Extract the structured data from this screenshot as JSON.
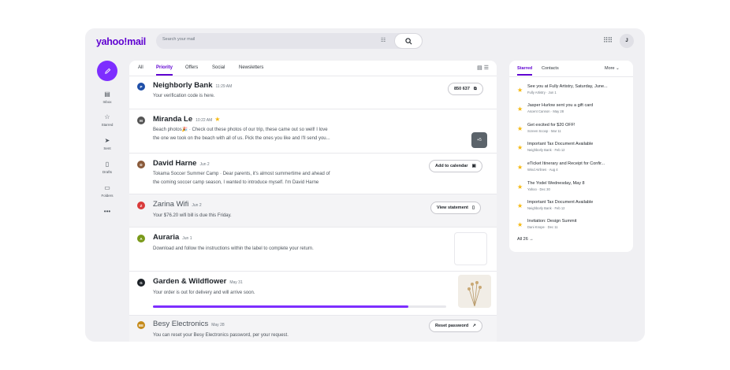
{
  "app": {
    "logo": "yahoo!mail"
  },
  "search": {
    "placeholder": "Search your mail"
  },
  "user": {
    "initial": "J"
  },
  "colors": {
    "accent": "#5f01d1",
    "compose": "#7d2eff",
    "star": "#f5b80e"
  },
  "rail": [
    {
      "label": "Inbox",
      "icon": "inbox-icon"
    },
    {
      "label": "Starred",
      "icon": "star-outline-icon"
    },
    {
      "label": "Sent",
      "icon": "send-icon"
    },
    {
      "label": "Drafts",
      "icon": "draft-icon"
    },
    {
      "label": "Folders",
      "icon": "folder-icon"
    }
  ],
  "tabs": [
    "All",
    "Priority",
    "Offers",
    "Social",
    "Newsletters"
  ],
  "active_tab": "Priority",
  "messages": [
    {
      "sender": "Neighborly Bank",
      "time": "11:29 AM",
      "snippet": "Your verification code is here.",
      "action": "850 637"
    },
    {
      "sender": "Miranda Le",
      "time": "10:22 AM",
      "snippet1": "Beach photos🎉 · Check out these photos of our trip, these came out so well! I love",
      "snippet2": "the one we took on the beach with all of us. Pick the ones you like and I'll send you...",
      "more": "+5"
    },
    {
      "sender": "David Harne",
      "time": "Jun 2",
      "snippet1": "Tokama Soccer Summer Camp · Dear parents, it's almost summertime and ahead of",
      "snippet2": "the coming soccer camp season, I wanted to introduce myself. I'm David Harne",
      "action": "Add to calendar"
    },
    {
      "sender": "Zarina Wifi",
      "time": "Jun 2",
      "snippet": "Your $76.20 wifi bill is due this Friday.",
      "action": "View statement"
    },
    {
      "sender": "Auraria",
      "time": "Jun 1",
      "snippet": "Download and follow the instructions within the label to complete your return."
    },
    {
      "sender": "Garden & Wildflower",
      "time": "May 31",
      "snippet": "Your order is out for delivery and will arrive soon.",
      "progress": 0.87
    },
    {
      "sender": "Besy Electronics",
      "time": "May 28",
      "snippet": "You can reset your Besy Electronics password, per your request.",
      "action": "Reset password"
    }
  ],
  "panel": {
    "tabs": [
      "Starred",
      "Contacts"
    ],
    "more": "More",
    "items": [
      {
        "title": "See you at Fully Artistry, Saturday, June...",
        "meta": "Fully Artistry · Jun 1"
      },
      {
        "title": "Jasper Hurlow sent you a gift card",
        "meta": "Ascent Cannon · May 28"
      },
      {
        "title": "Get excited for $20 OFF!",
        "meta": "Screen Scoop · Mar 11"
      },
      {
        "title": "Important Tax Document Available",
        "meta": "Neighborly Bank · Feb 12"
      },
      {
        "title": "eTicket Itinerary and Receipt for Confir...",
        "meta": "Wind Airlines · Aug 4"
      },
      {
        "title": "The Yodel Wednesday, May 8",
        "meta": "Yahoo · Dec 30"
      },
      {
        "title": "Important Tax Document Available",
        "meta": "Neighborly Bank · Feb 12"
      },
      {
        "title": "Invitation: Design Summit",
        "meta": "Dani Knope · Dec 11"
      }
    ],
    "all": "All 26"
  }
}
